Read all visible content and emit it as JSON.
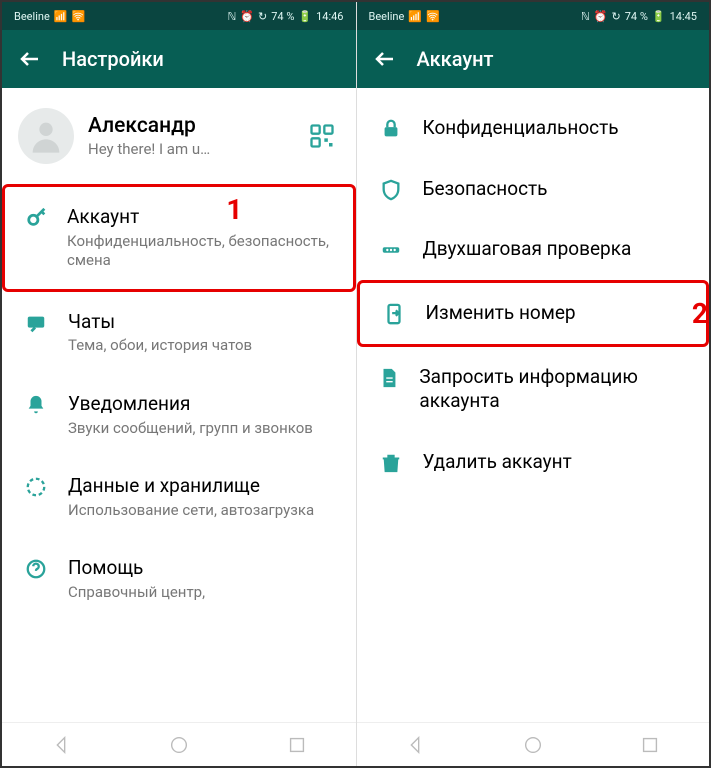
{
  "left": {
    "status": {
      "carrier": "Beeline",
      "battery": "74 %",
      "time": "14:46"
    },
    "appbar": {
      "title": "Настройки"
    },
    "profile": {
      "name": "Александр",
      "status": "Hey there! I am u…"
    },
    "items": [
      {
        "icon": "key",
        "title": "Аккаунт",
        "sub": "Конфиденциальность, безопасность, смена",
        "hl": true,
        "badge": "1"
      },
      {
        "icon": "chat",
        "title": "Чаты",
        "sub": "Тема, обои, история чатов"
      },
      {
        "icon": "bell",
        "title": "Уведомления",
        "sub": "Звуки сообщений, групп и звонков"
      },
      {
        "icon": "data",
        "title": "Данные и хранилище",
        "sub": "Использование сети, автозагрузка"
      },
      {
        "icon": "help",
        "title": "Помощь",
        "sub": "Справочный центр,"
      }
    ]
  },
  "right": {
    "status": {
      "carrier": "Beeline",
      "battery": "74 %",
      "time": "14:45"
    },
    "appbar": {
      "title": "Аккаунт"
    },
    "items": [
      {
        "icon": "lock",
        "title": "Конфиденциальность"
      },
      {
        "icon": "shield",
        "title": "Безопасность"
      },
      {
        "icon": "dots",
        "title": "Двухшаговая проверка"
      },
      {
        "icon": "phone",
        "title": "Изменить номер",
        "hl": true,
        "badge": "2"
      },
      {
        "icon": "doc",
        "title": "Запросить информацию аккаунта"
      },
      {
        "icon": "trash",
        "title": "Удалить аккаунт"
      }
    ]
  }
}
